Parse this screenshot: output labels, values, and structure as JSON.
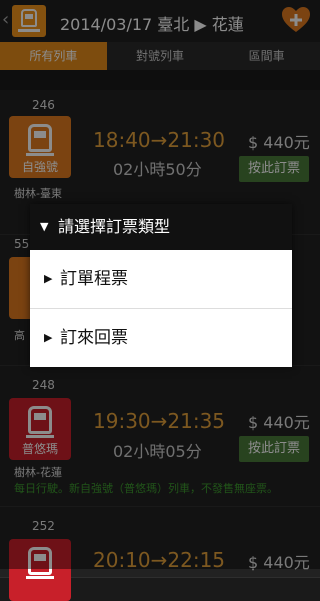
{
  "header": {
    "title": "2014/03/17 臺北 ▶ 花蓮",
    "back_icon": "chevron-left-icon",
    "logo_icon": "train-icon",
    "favorite_icon": "heart-plus-icon",
    "accent": "#e48b1b"
  },
  "tabs": [
    {
      "label": "所有列車",
      "active": true
    },
    {
      "label": "對號列車",
      "active": false
    },
    {
      "label": "區間車",
      "active": false
    }
  ],
  "trains": [
    {
      "number": "246",
      "type": "自強號",
      "type_color": "#e07b1f",
      "route": "樹林-臺東",
      "times": "18:40→21:30",
      "duration": "02小時50分",
      "price": "$ 440元",
      "book_label": "按此訂票",
      "note": ""
    },
    {
      "number": "55",
      "type": "自",
      "type_color": "#e07b1f",
      "route": "高",
      "times": "",
      "duration": "",
      "price": "",
      "book_label": "",
      "note": ""
    },
    {
      "number": "248",
      "type": "普悠瑪",
      "type_color": "#c8202a",
      "route": "樹林-花蓮",
      "times": "19:30→21:35",
      "duration": "02小時05分",
      "price": "$ 440元",
      "book_label": "按此訂票",
      "note": "每日行駛。新自強號（普悠瑪）列車，不發售無座票。"
    },
    {
      "number": "252",
      "type": "",
      "type_color": "#c8202a",
      "route": "",
      "times": "20:10→22:15",
      "duration": "",
      "price": "$ 440元",
      "book_label": "",
      "note": ""
    }
  ],
  "dialog": {
    "title": "請選擇訂票類型",
    "options": [
      "訂單程票",
      "訂來回票"
    ]
  }
}
